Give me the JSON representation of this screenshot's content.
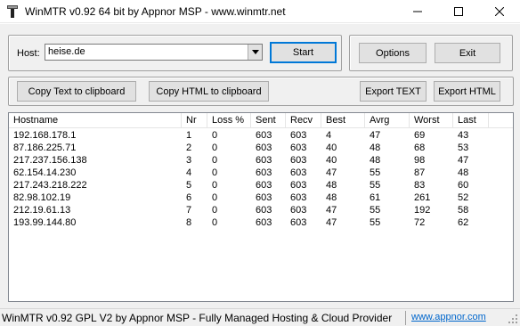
{
  "window": {
    "title": "WinMTR v0.92 64 bit by Appnor MSP - www.winmtr.net"
  },
  "host": {
    "label": "Host:",
    "value": "heise.de"
  },
  "buttons": {
    "start": "Start",
    "options": "Options",
    "exit": "Exit",
    "copy_text": "Copy Text to clipboard",
    "copy_html": "Copy HTML to clipboard",
    "export_text": "Export TEXT",
    "export_html": "Export HTML"
  },
  "table": {
    "columns": [
      "Hostname",
      "Nr",
      "Loss %",
      "Sent",
      "Recv",
      "Best",
      "Avrg",
      "Worst",
      "Last"
    ],
    "rows": [
      [
        "192.168.178.1",
        "1",
        "0",
        "603",
        "603",
        "4",
        "47",
        "69",
        "43"
      ],
      [
        "87.186.225.71",
        "2",
        "0",
        "603",
        "603",
        "40",
        "48",
        "68",
        "53"
      ],
      [
        "217.237.156.138",
        "3",
        "0",
        "603",
        "603",
        "40",
        "48",
        "98",
        "47"
      ],
      [
        "62.154.14.230",
        "4",
        "0",
        "603",
        "603",
        "47",
        "55",
        "87",
        "48"
      ],
      [
        "217.243.218.222",
        "5",
        "0",
        "603",
        "603",
        "48",
        "55",
        "83",
        "60"
      ],
      [
        "82.98.102.19",
        "6",
        "0",
        "603",
        "603",
        "48",
        "61",
        "261",
        "52"
      ],
      [
        "212.19.61.13",
        "7",
        "0",
        "603",
        "603",
        "47",
        "55",
        "192",
        "58"
      ],
      [
        "193.99.144.80",
        "8",
        "0",
        "603",
        "603",
        "47",
        "55",
        "72",
        "62"
      ]
    ]
  },
  "status": {
    "text": "WinMTR v0.92 GPL V2 by Appnor MSP - Fully Managed Hosting & Cloud Provider",
    "link": "www.appnor.com"
  },
  "icons": {
    "app": "winmtr-app-icon",
    "minimize": "minimize-icon",
    "maximize": "maximize-icon",
    "close": "close-icon",
    "dropdown": "chevron-down-icon",
    "grip": "resize-grip-icon"
  }
}
